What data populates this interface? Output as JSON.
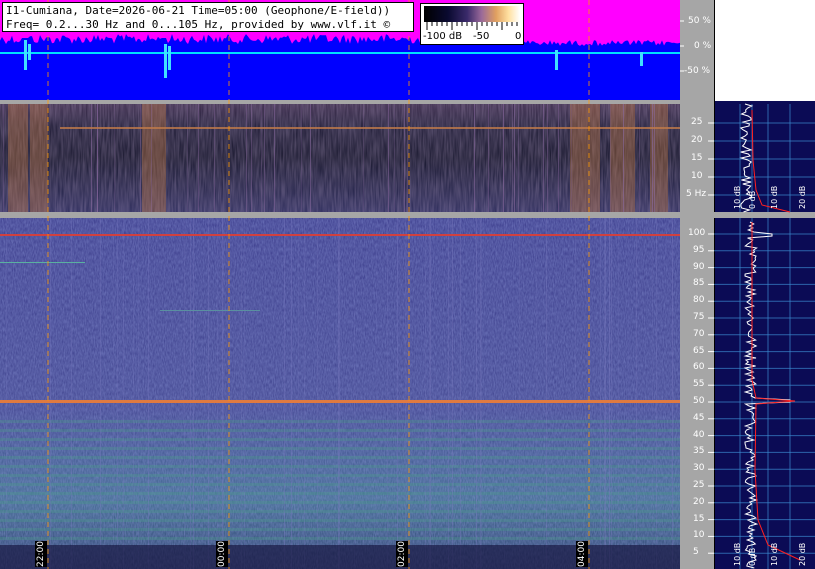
{
  "header": {
    "title_line1": "I1-Cumiana, Date=2026-06-21 Time=05:00 (Geophone/E-field))",
    "title_line2": "Freq= 0.2...30 Hz and 0...105 Hz, provided by www.vlf.it ©"
  },
  "color_scale": {
    "labels": [
      "-100 dB",
      "-50",
      "0"
    ]
  },
  "amplitude_axis": {
    "labels": [
      "50 %",
      "0 %",
      "-50 %"
    ]
  },
  "low_freq_axis": {
    "labels": [
      "25",
      "20",
      "15",
      "10",
      "5 Hz"
    ]
  },
  "high_freq_axis": {
    "labels": [
      "100",
      "95",
      "90",
      "85",
      "80",
      "75",
      "70",
      "65",
      "60",
      "55",
      "50",
      "45",
      "40",
      "35",
      "30",
      "25",
      "20",
      "15",
      "10",
      "5"
    ]
  },
  "time_axis": {
    "labels": [
      "22:00",
      "00:00",
      "02:00",
      "04:00"
    ]
  },
  "side_panel": {
    "upper_labels": [
      "10 dB",
      "0 dB",
      "10 dB",
      "20 dB"
    ],
    "lower_labels": [
      "10 dB",
      "0 dB",
      "10 dB",
      "20 dB"
    ]
  },
  "colors": {
    "waveform_fill": "#0000ff",
    "waveform_envelope": "#ff00ff",
    "lf_background": "#15152a",
    "hf_background": "#3e3e8c",
    "marker_line": "#ff9900",
    "side_panel_bg": "#0b0b55",
    "axis_panel_bg": "#a6a6a6"
  }
}
